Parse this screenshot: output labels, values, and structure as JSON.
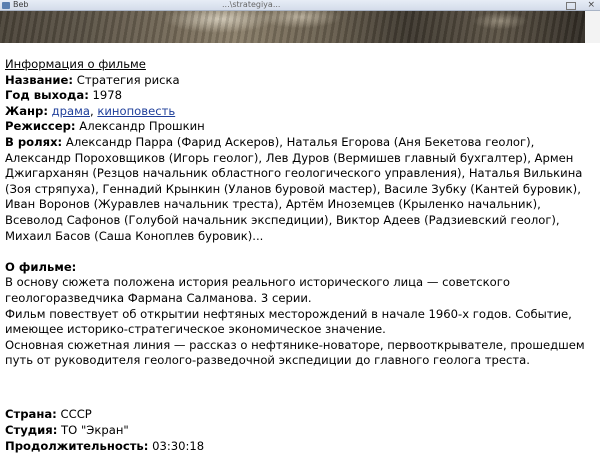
{
  "browser": {
    "tab_title": "Beb",
    "url": "...\\strategiya...",
    "close_glyph": "×"
  },
  "info": {
    "section_title": "Информация о фильме",
    "title_label": "Название:",
    "title_value": "Стратегия риска",
    "year_label": "Год выхода:",
    "year_value": "1978",
    "genre_label": "Жанр:",
    "genre_links": [
      "драма",
      "киноповесть"
    ],
    "genre_sep": ",",
    "director_label": "Режиссер:",
    "director_value": "Александр Прошкин",
    "cast_label": "В ролях:",
    "cast_value": "Александр Парра (Фарид Аскеров), Наталья Егорова (Аня Бекетова геолог), Александр Пороховщиков (Игорь геолог), Лев Дуров (Вермишев главный бухгалтер), Армен Джигарханян (Резцов начальник областного геологического управления), Наталья Вилькина (Зоя стряпуха), Геннадий Крынкин (Уланов буровой мастер), Василе Зубку (Кантей буровик), Иван Воронов (Журавлев начальник треста), Артём Иноземцев (Крыленко начальник), Всеволод Сафонов (Голубой начальник экспедиции), Виктор Адеев (Радзиевский геолог), Михаил Басов (Саша Коноплев буровик)..."
  },
  "about": {
    "label": "О фильме:",
    "p1": "В основу сюжета положена история реального исторического лица — советского геологоразведчика Фармана Салманова. 3 серии.",
    "p2": "Фильм повествует об открытии нефтяных месторождений в начале 1960-х годов. Событие, имеющее историко-стратегическое экономическое значение.",
    "p3": "Основная сюжетная линия — рассказ о нефтянике-новаторе, первооткрывателе, прошедшем путь от руководителя геолого-разведочной экспедиции до главного геолога треста."
  },
  "details": {
    "country_label": "Страна:",
    "country_value": "СССР",
    "studio_label": "Студия:",
    "studio_value": "ТО \"Экран\"",
    "duration_label": "Продолжительность:",
    "duration_value": "03:30:18"
  }
}
